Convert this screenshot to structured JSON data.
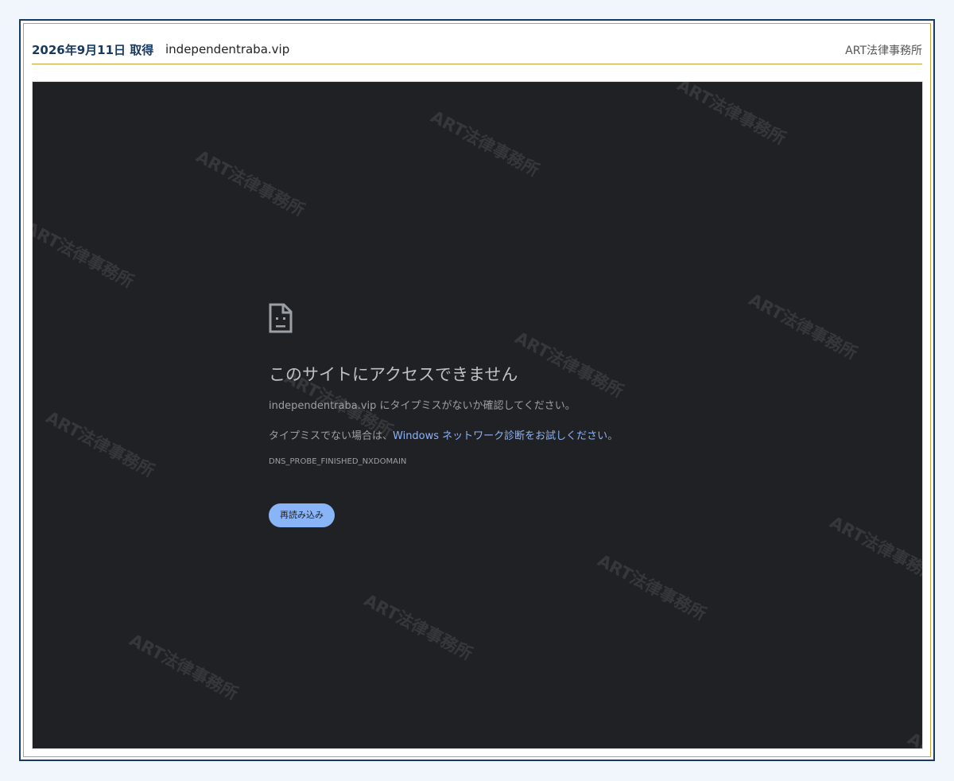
{
  "header": {
    "capture_date": "2026年9月11日 取得",
    "domain": "independentraba.vip",
    "firm_name": "ART法律事務所"
  },
  "watermark": {
    "text": "ART法律事務所"
  },
  "error_page": {
    "icon": "sad-file-icon",
    "title": "このサイトにアクセスできません",
    "domain": "independentraba.vip",
    "typo_message": " にタイプミスがないか確認してください。",
    "not_typo_prefix": "タイプミスでない場合は、",
    "diagnostic_link": "Windows ネットワーク診断をお試しください",
    "not_typo_suffix": "。",
    "error_code": "DNS_PROBE_FINISHED_NXDOMAIN",
    "reload_label": "再読み込み"
  },
  "colors": {
    "frame_navy": "#173a60",
    "frame_gold": "#c9a13b",
    "error_bg": "#202124",
    "link_blue": "#8ab4f8"
  }
}
